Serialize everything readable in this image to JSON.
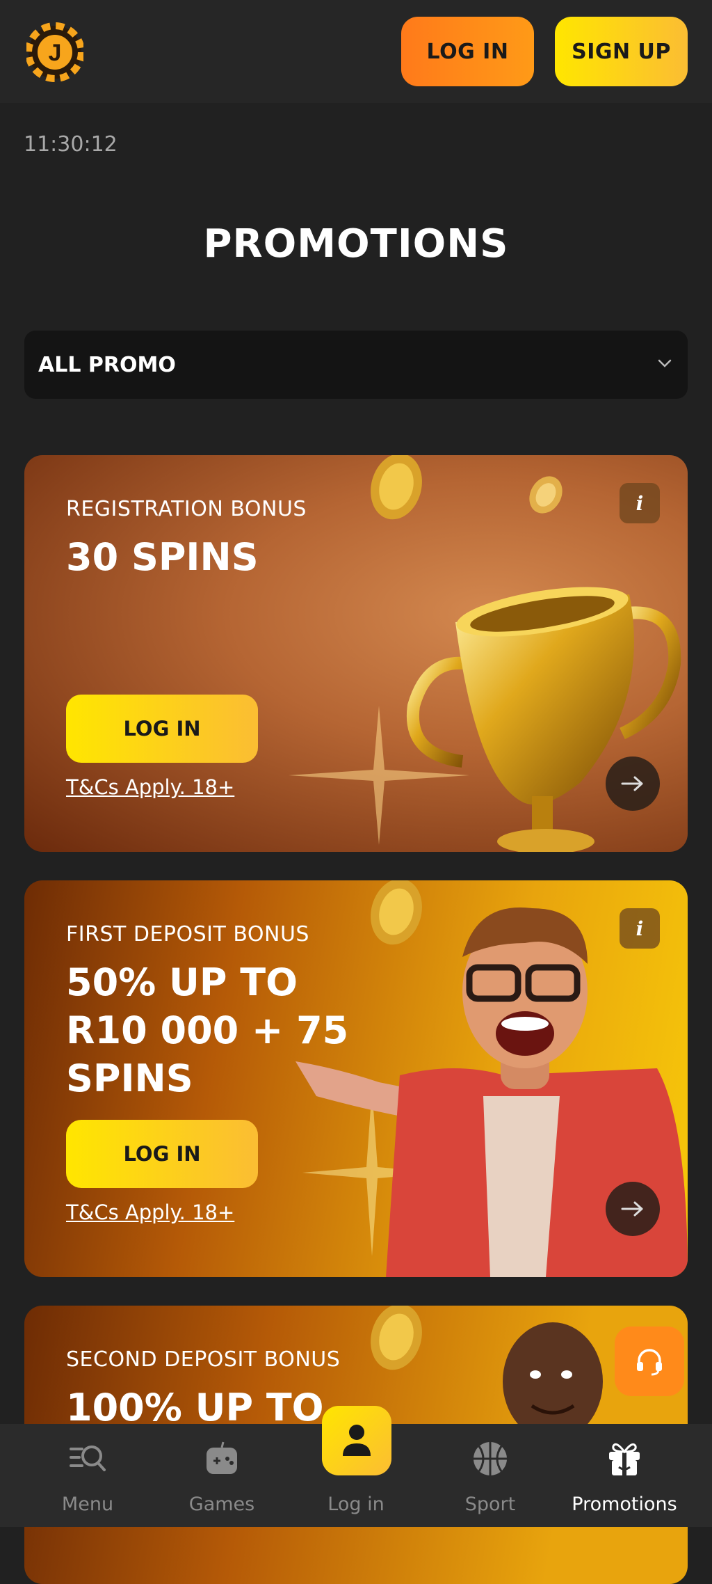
{
  "header": {
    "login_label": "LOG IN",
    "signup_label": "SIGN UP"
  },
  "status": {
    "time": "11:30:12"
  },
  "page": {
    "title": "PROMOTIONS"
  },
  "filter": {
    "selected": "ALL PROMO"
  },
  "promos": [
    {
      "subtitle": "REGISTRATION BONUS",
      "title": "30 SPINS",
      "button": "LOG IN",
      "terms": "T&Cs Apply. 18+"
    },
    {
      "subtitle": "FIRST DEPOSIT BONUS",
      "title": "50% UP TO R10 000 + 75 SPINS",
      "button": "LOG IN",
      "terms": "T&Cs Apply. 18+"
    },
    {
      "subtitle": "SECOND DEPOSIT BONUS",
      "title": "100% UP TO"
    }
  ],
  "bottom_nav": {
    "items": [
      {
        "label": "Menu",
        "icon": "menu-search-icon"
      },
      {
        "label": "Games",
        "icon": "gamepad-icon"
      },
      {
        "label": "Log in",
        "icon": "user-icon"
      },
      {
        "label": "Sport",
        "icon": "basketball-icon"
      },
      {
        "label": "Promotions",
        "icon": "gift-icon"
      }
    ],
    "active": "Promotions"
  },
  "colors": {
    "background": "#212121",
    "accent_orange": "#ff8a1a",
    "accent_yellow": "#ffd60a"
  }
}
